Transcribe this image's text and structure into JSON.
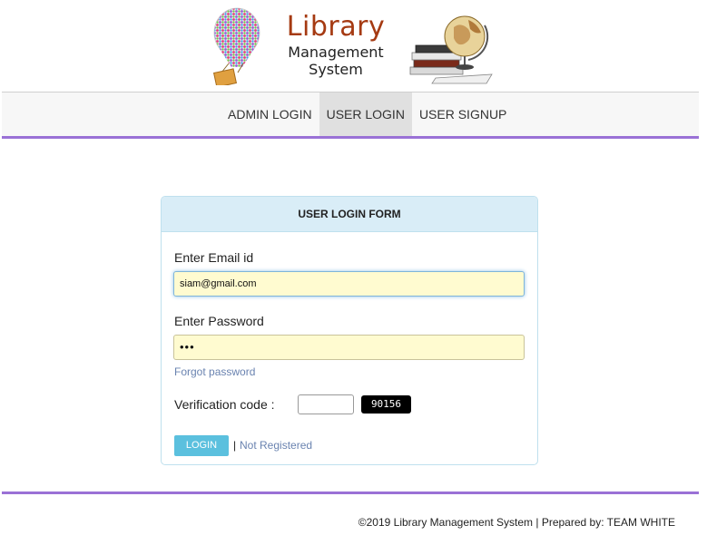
{
  "brand": {
    "title": "Library",
    "subtitle_line1": "Management",
    "subtitle_line2": "System"
  },
  "nav": {
    "items": [
      {
        "label": "ADMIN LOGIN",
        "active": false
      },
      {
        "label": "USER LOGIN",
        "active": true
      },
      {
        "label": "USER SIGNUP",
        "active": false
      }
    ]
  },
  "form": {
    "heading": "USER LOGIN FORM",
    "email_label": "Enter Email id",
    "email_value": "siam@gmail.com",
    "password_label": "Enter Password",
    "password_mask": "•••",
    "forgot_label": "Forgot password",
    "verification_label": "Verification code :",
    "verification_value": "",
    "captcha_code": "90156",
    "login_label": "LOGIN",
    "separator": "|",
    "not_registered_label": "Not Registered"
  },
  "footer": {
    "text": "©2019 Library Management System | Prepared by: TEAM WHITE"
  },
  "colors": {
    "accent_purple": "#9a71d6",
    "panel_heading_bg": "#d9edf7",
    "input_autofill_bg": "#fffbd0",
    "login_button": "#5bc0de",
    "brand_title": "#a53a12",
    "link": "#6a83b0"
  },
  "icons": {
    "left_logo": "hot-air-balloon-icon",
    "right_logo": "globe-books-icon"
  }
}
